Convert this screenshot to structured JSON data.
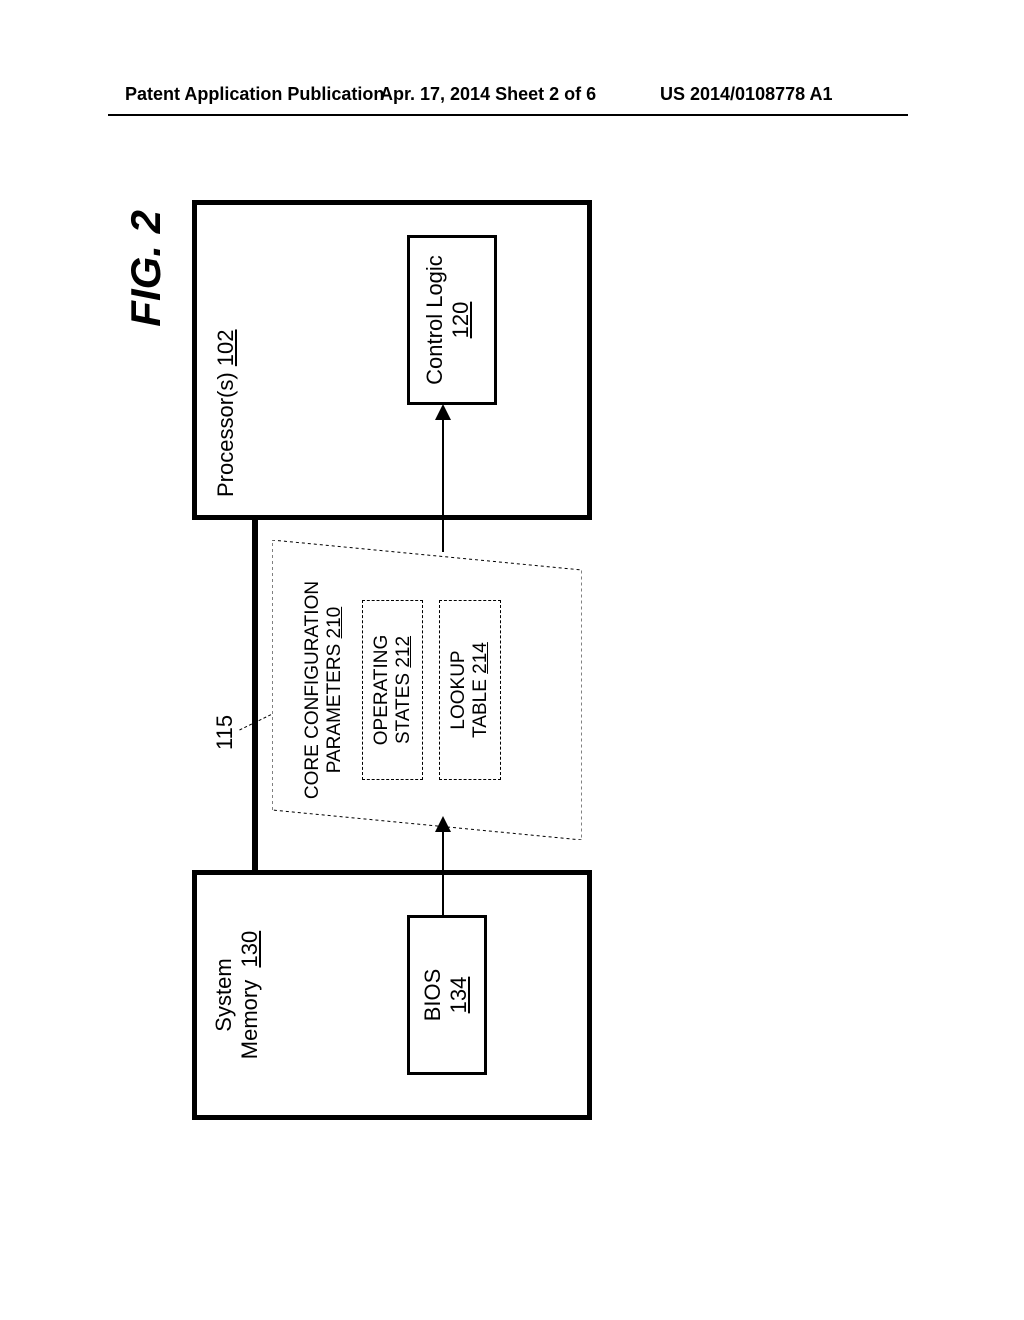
{
  "header": {
    "left": "Patent Application Publication",
    "center": "Apr. 17, 2014  Sheet 2 of 6",
    "right": "US 2014/0108778 A1"
  },
  "figure": {
    "label": "FIG. 2",
    "ref_115": "115",
    "system_memory": {
      "title": "System\nMemory",
      "num": "130",
      "bios_label": "BIOS",
      "bios_num": "134"
    },
    "middle": {
      "title": "CORE CONFIGURATION\nPARAMETERS",
      "title_num": "210",
      "operating_label": "OPERATING\nSTATES",
      "operating_num": "212",
      "lookup_label": "LOOKUP\nTABLE",
      "lookup_num": "214"
    },
    "processor": {
      "title": "Processor(s)",
      "num": "102",
      "control_label": "Control Logic",
      "control_num": "120"
    }
  }
}
